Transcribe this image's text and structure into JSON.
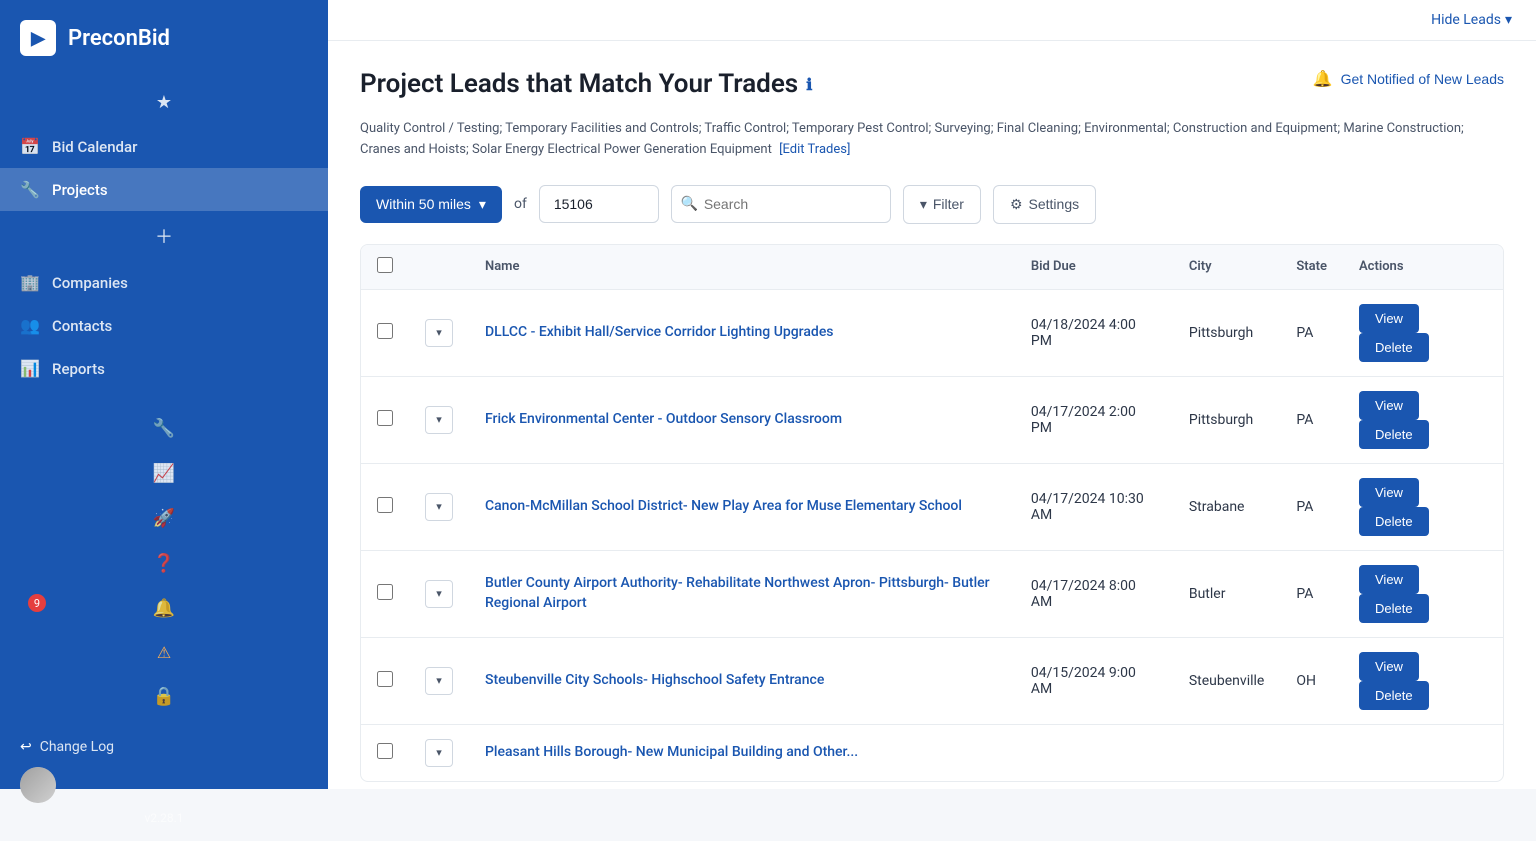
{
  "sidebar": {
    "brand": "PreconBid",
    "logo_char": "▶",
    "nav_items": [
      {
        "id": "favorites",
        "label": "",
        "icon": "★",
        "active": false,
        "icon_only": true
      },
      {
        "id": "bid-calendar",
        "label": "Bid Calendar",
        "icon": "📅",
        "active": false
      },
      {
        "id": "projects",
        "label": "Projects",
        "icon": "🔧",
        "active": true
      },
      {
        "id": "add",
        "label": "",
        "icon": "＋",
        "active": false,
        "icon_only": true
      },
      {
        "id": "companies",
        "label": "Companies",
        "icon": "🏢",
        "active": false
      },
      {
        "id": "contacts",
        "label": "Contacts",
        "icon": "👥",
        "active": false
      },
      {
        "id": "reports",
        "label": "Reports",
        "icon": "📊",
        "active": false
      }
    ],
    "icon_only_bottom": [
      {
        "id": "tool",
        "icon": "🔧"
      },
      {
        "id": "chart",
        "icon": "📈"
      },
      {
        "id": "rocket",
        "icon": "🚀"
      },
      {
        "id": "help",
        "icon": "❓"
      },
      {
        "id": "notifications",
        "icon": "🔔",
        "badge": "9"
      },
      {
        "id": "warning",
        "icon": "⚠"
      },
      {
        "id": "lock",
        "icon": "🔒"
      }
    ],
    "footer": {
      "change_log_label": "Change Log",
      "change_log_icon": "↩",
      "version": "v2.28.1"
    }
  },
  "topbar": {
    "hide_leads_label": "Hide Leads",
    "hide_leads_icon": "▾"
  },
  "page": {
    "title": "Project Leads that Match Your Trades",
    "title_info_icon": "ℹ",
    "notify_label": "Get Notified of New Leads",
    "notify_icon": "🔔",
    "trades_text": "Quality Control / Testing; Temporary Facilities and Controls; Traffic Control; Temporary Pest Control; Surveying; Final Cleaning; Environmental; Construction and Equipment; Marine Construction; Cranes and Hoists; Solar Energy Electrical Power Generation Equipment",
    "edit_trades_label": "[Edit Trades]"
  },
  "filters": {
    "distance_label": "Within 50 miles",
    "distance_icon": "▾",
    "of_label": "of",
    "zip_value": "15106",
    "search_placeholder": "Search",
    "filter_label": "Filter",
    "filter_icon": "▾",
    "settings_label": "Settings",
    "settings_icon": "⚙"
  },
  "table": {
    "columns": [
      "Name",
      "Bid Due",
      "City",
      "State",
      "Actions"
    ],
    "view_label": "View",
    "delete_label": "Delete",
    "rows": [
      {
        "name": "DLLCC - Exhibit Hall/Service Corridor Lighting Upgrades",
        "bid_due": "04/18/2024 4:00 PM",
        "city": "Pittsburgh",
        "state": "PA"
      },
      {
        "name": "Frick Environmental Center - Outdoor Sensory Classroom",
        "bid_due": "04/17/2024 2:00 PM",
        "city": "Pittsburgh",
        "state": "PA"
      },
      {
        "name": "Canon-McMillan School District- New Play Area for Muse Elementary School",
        "bid_due": "04/17/2024 10:30 AM",
        "city": "Strabane",
        "state": "PA"
      },
      {
        "name": "Butler County Airport Authority- Rehabilitate Northwest Apron- Pittsburgh- Butler Regional Airport",
        "bid_due": "04/17/2024 8:00 AM",
        "city": "Butler",
        "state": "PA"
      },
      {
        "name": "Steubenville City Schools- Highschool Safety Entrance",
        "bid_due": "04/15/2024 9:00 AM",
        "city": "Steubenville",
        "state": "OH"
      },
      {
        "name": "Pleasant Hills Borough- New Municipal Building and Other...",
        "bid_due": "",
        "city": "",
        "state": ""
      }
    ]
  }
}
